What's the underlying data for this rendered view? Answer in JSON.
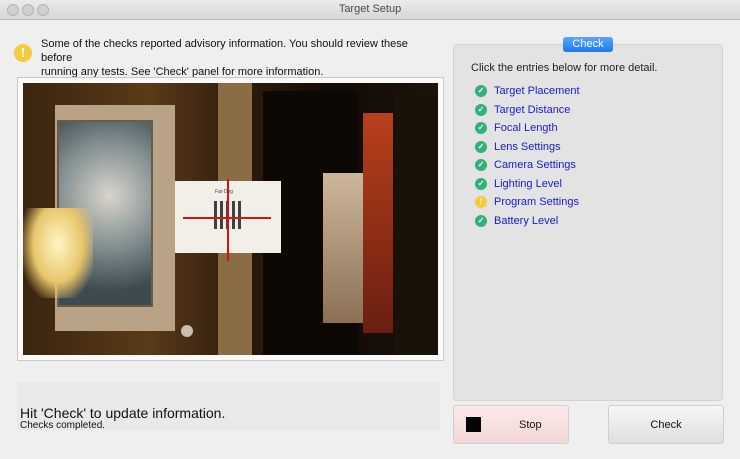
{
  "window": {
    "title": "Target Setup"
  },
  "advisory": {
    "icon": "warning-icon",
    "line1": "Some of the checks reported advisory information.  You should review these before",
    "line2": "running any tests.  See 'Check' panel for more information."
  },
  "camera_view": {
    "target_card_text": "Fat·Dog"
  },
  "status": {
    "main": "Hit 'Check' to update information.",
    "sub": "Checks completed."
  },
  "check_panel": {
    "badge": "Check",
    "hint": "Click the entries below for more detail.",
    "items": [
      {
        "label": "Target Placement",
        "status": "ok"
      },
      {
        "label": "Target Distance",
        "status": "ok"
      },
      {
        "label": "Focal Length",
        "status": "ok"
      },
      {
        "label": "Lens Settings",
        "status": "ok"
      },
      {
        "label": "Camera Settings",
        "status": "ok"
      },
      {
        "label": "Lighting Level",
        "status": "ok"
      },
      {
        "label": "Program Settings",
        "status": "warn"
      },
      {
        "label": "Battery Level",
        "status": "ok"
      }
    ]
  },
  "buttons": {
    "stop": "Stop",
    "check": "Check"
  },
  "colors": {
    "ok": "#33b07a",
    "warn": "#f2cc3a",
    "link": "#1a1ad0",
    "badge": "#1d78f0"
  }
}
